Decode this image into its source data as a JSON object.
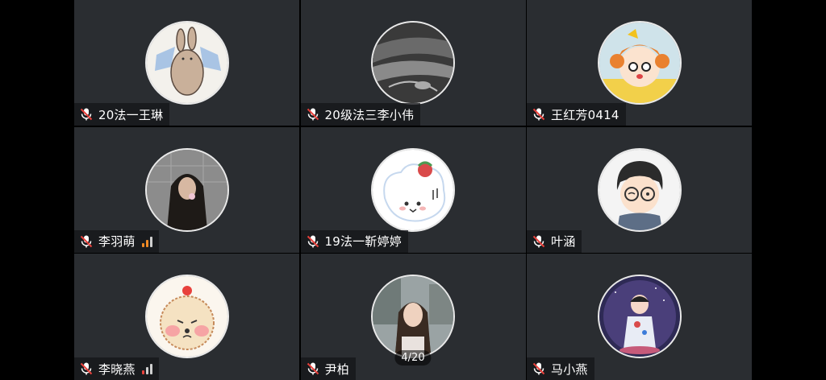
{
  "participants": [
    {
      "name": "20法一王琳",
      "avatar": "bunny-avatar",
      "muted": true
    },
    {
      "name": "20级法三李小伟",
      "avatar": "bw-photo-avatar",
      "muted": true
    },
    {
      "name": "王红芳0414",
      "avatar": "cartoon-girl-avatar",
      "muted": true
    },
    {
      "name": "李羽萌",
      "avatar": "girl-photo-avatar",
      "muted": true,
      "signal_color": "#f08a24"
    },
    {
      "name": "19法一靳婷婷",
      "avatar": "white-dog-avatar",
      "muted": true
    },
    {
      "name": "叶涵",
      "avatar": "conan-avatar",
      "muted": true
    },
    {
      "name": "李晓燕",
      "avatar": "bear-avatar",
      "muted": true,
      "signal_color": "#e8413c"
    },
    {
      "name": "尹柏",
      "avatar": "girl-portrait-avatar",
      "muted": true
    },
    {
      "name": "马小燕",
      "avatar": "astronaut-avatar",
      "muted": true
    }
  ],
  "page_indicator": "4/20",
  "colors": {
    "mic_muted": "#e8413c",
    "tile_bg": "#2a2d31"
  }
}
